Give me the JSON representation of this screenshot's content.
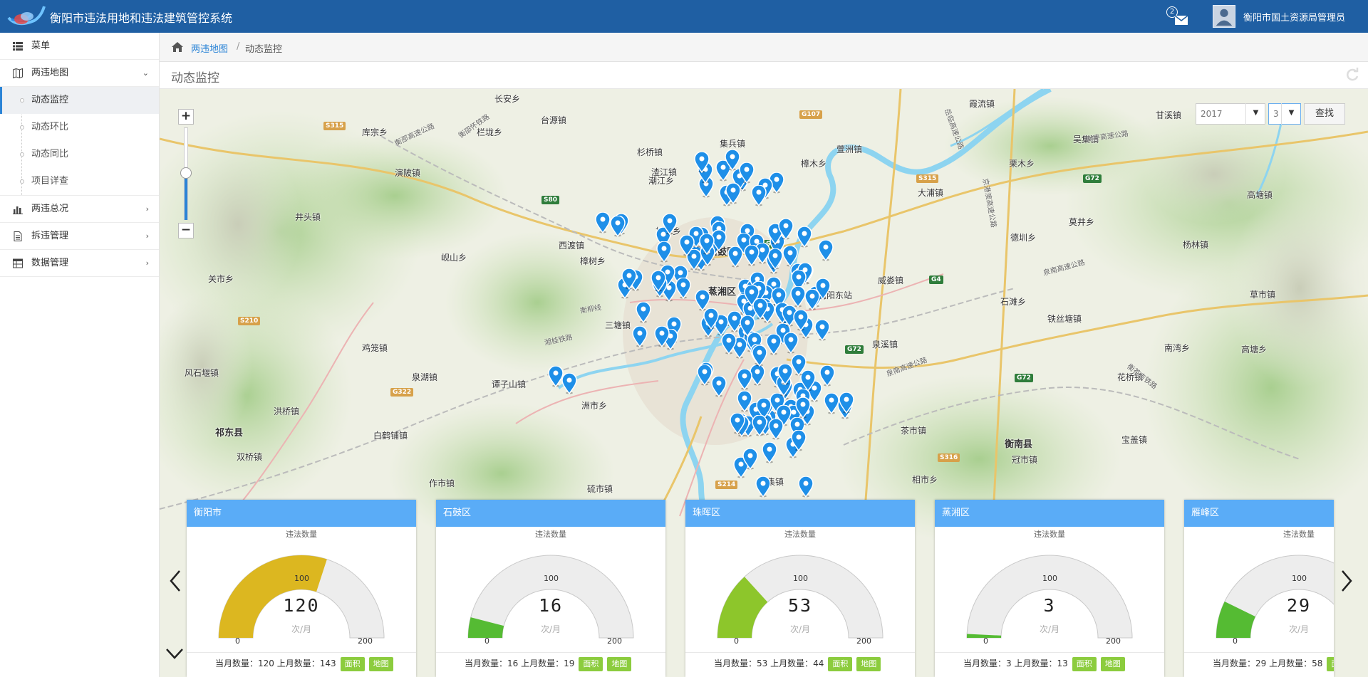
{
  "header": {
    "title": "衡阳市违法用地和违法建筑管控系统",
    "mail_count": "2",
    "user": "衡阳市国土资源局管理员"
  },
  "sidebar": {
    "items": [
      {
        "label": "菜单",
        "icon": "list-icon"
      },
      {
        "label": "两违地图",
        "icon": "map-icon",
        "expanded": true
      },
      {
        "label": "两违总况",
        "icon": "bar-chart-icon"
      },
      {
        "label": "拆违管理",
        "icon": "document-icon"
      },
      {
        "label": "数据管理",
        "icon": "table-icon"
      }
    ],
    "subitems": [
      {
        "label": "动态监控",
        "active": true
      },
      {
        "label": "动态环比"
      },
      {
        "label": "动态同比"
      },
      {
        "label": "项目详查"
      }
    ]
  },
  "breadcrumb": {
    "link": "两违地图",
    "separator": "/",
    "current": "动态监控"
  },
  "panel": {
    "title": "动态监控"
  },
  "filter": {
    "year": "2017",
    "month": "3",
    "search_label": "查找"
  },
  "map": {
    "places": [
      {
        "name": "长安乡"
      },
      {
        "name": "台源镇"
      },
      {
        "name": "栏垅乡"
      },
      {
        "name": "库宗乡"
      },
      {
        "name": "渣江镇"
      },
      {
        "name": "集兵镇"
      },
      {
        "name": "杉桥镇"
      },
      {
        "name": "樟木乡"
      },
      {
        "name": "萱洲镇"
      },
      {
        "name": "演陂镇"
      },
      {
        "name": "井头镇"
      },
      {
        "name": "潮江乡"
      },
      {
        "name": "板市乡"
      },
      {
        "name": "西渡镇"
      },
      {
        "name": "樟树乡"
      },
      {
        "name": "岘山乡"
      },
      {
        "name": "石鼓区",
        "big": true
      },
      {
        "name": "蒸湘区",
        "big": true
      },
      {
        "name": "珠晖区",
        "big": true
      },
      {
        "name": "雁峰区",
        "big": true
      },
      {
        "name": "关市乡"
      },
      {
        "name": "三塘镇"
      },
      {
        "name": "鸡笼镇"
      },
      {
        "name": "风石堰镇"
      },
      {
        "name": "泉湖镇"
      },
      {
        "name": "谭子山镇"
      },
      {
        "name": "洲市乡"
      },
      {
        "name": "洪桥镇"
      },
      {
        "name": "祁东县",
        "big": true
      },
      {
        "name": "白鹤铺镇"
      },
      {
        "name": "双桥镇"
      },
      {
        "name": "作市镇"
      },
      {
        "name": "硫市镇"
      },
      {
        "name": "云集镇"
      },
      {
        "name": "茶市镇"
      },
      {
        "name": "相市乡"
      },
      {
        "name": "衡南县",
        "big": true
      },
      {
        "name": "冠市镇"
      },
      {
        "name": "宝盖镇"
      },
      {
        "name": "泉溪镇"
      },
      {
        "name": "石滩乡"
      },
      {
        "name": "威娄镇"
      },
      {
        "name": "德圳乡"
      },
      {
        "name": "铁丝塘镇"
      },
      {
        "name": "花桥镇"
      },
      {
        "name": "南湾乡"
      },
      {
        "name": "高塘乡"
      },
      {
        "name": "杨林镇"
      },
      {
        "name": "莫井乡"
      },
      {
        "name": "草市镇"
      },
      {
        "name": "栗木乡"
      },
      {
        "name": "吴集镇"
      },
      {
        "name": "高塘镇"
      },
      {
        "name": "甘溪镇"
      },
      {
        "name": "霞流镇"
      },
      {
        "name": "大浦镇"
      },
      {
        "name": "衡阳东站"
      }
    ],
    "road_labels": [
      "衡邵高速公路",
      "衡邵怀铁路",
      "湘桂铁路",
      "衡柳线",
      "湘桂铁路复线",
      "泉南高速公路",
      "衡茶吉铁路",
      "京港澳高速公路",
      "岳临高速公路",
      "衡枣高速公路",
      "泉南高速公路"
    ],
    "shields": [
      "S315",
      "S80",
      "G107",
      "S80",
      "G4",
      "G72",
      "S315",
      "G72",
      "S210",
      "G322",
      "S214",
      "S316",
      "G72"
    ],
    "pin_count": 150
  },
  "cards": [
    {
      "title": "衡阳市",
      "subtitle": "违法数量",
      "value": 120,
      "unit": "次/月",
      "min": "0",
      "mid": "100",
      "max": "200",
      "color": "#dcb720",
      "current_month": 120,
      "last_month": 143,
      "area_btn": "面积",
      "map_btn": "地图"
    },
    {
      "title": "石鼓区",
      "subtitle": "违法数量",
      "value": 16,
      "unit": "次/月",
      "min": "0",
      "mid": "100",
      "max": "200",
      "color": "#55bb33",
      "current_month": 16,
      "last_month": 19,
      "area_btn": "面积",
      "map_btn": "地图"
    },
    {
      "title": "珠晖区",
      "subtitle": "违法数量",
      "value": 53,
      "unit": "次/月",
      "min": "0",
      "mid": "100",
      "max": "200",
      "color": "#8dc62b",
      "current_month": 53,
      "last_month": 44,
      "area_btn": "面积",
      "map_btn": "地图"
    },
    {
      "title": "蒸湘区",
      "subtitle": "违法数量",
      "value": 3,
      "unit": "次/月",
      "min": "0",
      "mid": "100",
      "max": "200",
      "color": "#55bb33",
      "current_month": 3,
      "last_month": 13,
      "area_btn": "面积",
      "map_btn": "地图"
    },
    {
      "title": "雁峰区",
      "subtitle": "违法数量",
      "value": 29,
      "unit": "次/月",
      "min": "0",
      "mid": "100",
      "max": "200",
      "color": "#55bb33",
      "current_month": 29,
      "last_month": 58,
      "area_btn": "面积",
      "map_btn": "地图"
    }
  ],
  "card_foot": {
    "current_label": "当月数量：",
    "last_label": "上月数量："
  },
  "colors": {
    "header": "#1f5fa3",
    "card_head": "#5aacf7",
    "accent": "#2b84d6",
    "pin": "#1e8fe8",
    "button_green": "#8ccc3e"
  }
}
